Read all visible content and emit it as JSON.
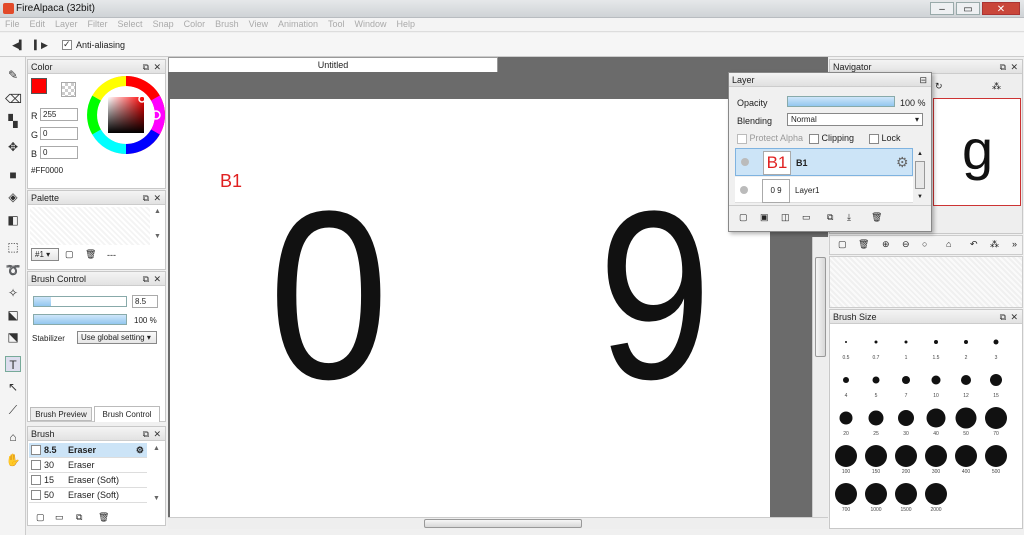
{
  "window": {
    "title": "FireAlpaca (32bit)"
  },
  "menu": [
    "File",
    "Edit",
    "Layer",
    "Filter",
    "Select",
    "Snap",
    "Color",
    "Brush",
    "View",
    "Animation",
    "Tool",
    "Window",
    "Help"
  ],
  "toolbar": {
    "antialias_label": "Anti-aliasing"
  },
  "color_panel": {
    "title": "Color",
    "r_label": "R",
    "r": "255",
    "g_label": "G",
    "g": "0",
    "b_label": "B",
    "b": "0",
    "hex": "#FF0000",
    "primary": "#ff0000"
  },
  "palette_panel": {
    "title": "Palette",
    "selector": "#1 ▾",
    "more": "---"
  },
  "brush_control": {
    "title": "Brush Control",
    "size": "8.5",
    "opacity": "100 %",
    "opacity_fraction": 1.0,
    "stabilizer_label": "Stabilizer",
    "stabilizer_value": "Use global setting",
    "tab_preview": "Brush Preview",
    "tab_control": "Brush Control"
  },
  "brush_panel": {
    "title": "Brush",
    "items": [
      {
        "size": "8.5",
        "name": "Eraser",
        "active": true
      },
      {
        "size": "30",
        "name": "Eraser",
        "active": false
      },
      {
        "size": "15",
        "name": "Eraser (Soft)",
        "active": false
      },
      {
        "size": "50",
        "name": "Eraser (Soft)",
        "active": false
      }
    ]
  },
  "document": {
    "tab": "Untitled",
    "label_text": "B1",
    "glyph_left": "0",
    "glyph_right": "9",
    "label_color": "#e02020"
  },
  "navigator": {
    "title": "Navigator",
    "preview_glyph": "g"
  },
  "layer_panel": {
    "title": "Layer",
    "opacity_label": "Opacity",
    "opacity_value": "100 %",
    "opacity_fraction": 1.0,
    "blending_label": "Blending",
    "blending_value": "Normal",
    "protect_alpha": "Protect Alpha",
    "clipping": "Clipping",
    "lock": "Lock",
    "layers": [
      {
        "name": "B1",
        "thumb": "B1",
        "active": true
      },
      {
        "name": "Layer1",
        "thumb": "0 9",
        "active": false
      }
    ]
  },
  "brush_size_panel": {
    "title": "Brush Size",
    "sizes": [
      "0.5",
      "0.7",
      "1",
      "1.5",
      "2",
      "3",
      "4",
      "5",
      "7",
      "10",
      "12",
      "15",
      "20",
      "25",
      "30",
      "40",
      "50",
      "70",
      "100",
      "150",
      "200",
      "300",
      "400",
      "500",
      "700",
      "1000",
      "1500",
      "2000"
    ]
  }
}
